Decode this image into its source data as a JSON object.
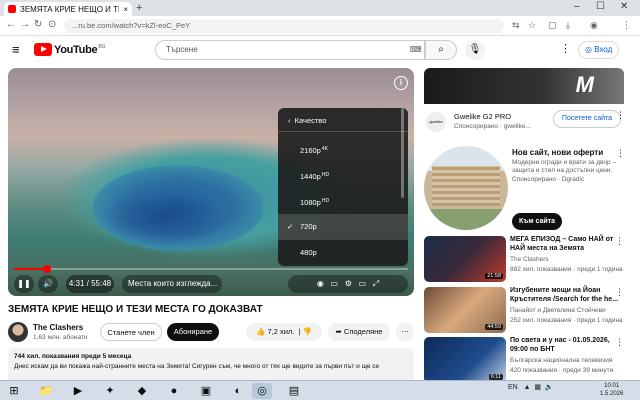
{
  "browser": {
    "tab_title": "ЗЕМЯТА КРИЕ НЕЩО И ТЕЗИ",
    "tab_close": "×",
    "new_tab": "+",
    "url": "...ru.be.com/watch?v=kZl-eoC_PeY",
    "window": {
      "minimize": "–",
      "maximize": "☐",
      "close": "✕"
    }
  },
  "youtube": {
    "logo_text": "YouTube",
    "country_code": "BG",
    "search_placeholder": "Търсене",
    "signin_label": "Вход"
  },
  "player": {
    "settings_header": "Качество",
    "quality_options": [
      {
        "label": "2160p",
        "badge": "4K"
      },
      {
        "label": "1440p",
        "badge": "HD"
      },
      {
        "label": "1080p",
        "badge": "HD"
      },
      {
        "label": "720p",
        "badge": ""
      },
      {
        "label": "480p",
        "badge": ""
      }
    ],
    "selected_quality": "720p",
    "time": "4:31 / 55:48",
    "chapter_pill": "Места които изглежда...",
    "progress_fraction": 0.083
  },
  "video": {
    "title": "ЗЕМЯТА КРИЕ НЕЩО И ТЕЗИ МЕСТА ГО ДОКАЗВАТ",
    "channel_name": "The Clashers",
    "subscribers": "1,63 млн. абонати",
    "join_label": "Станете член",
    "subscribe_label": "Абониране",
    "likes": "7,2 хил.",
    "share_label": "Споделяне",
    "description_stats": "744 хил. показвания  преди 5 месеца",
    "description_text": "Днес искам да ви покажа най-странните места на Земята! Сигурен съм, че много от тях ще видите за първи път и ще се"
  },
  "sidebar": {
    "ad1": {
      "title": "Gwelike G2 PRO",
      "sponsored": "Спонсорирано · gwelike...",
      "button": "Посетете сайта",
      "logo": "gwelike"
    },
    "ad2": {
      "title": "Нов сайт, нови оферти",
      "description": "Модерни огради и врати за двор – защита и стил на достъпни цени.",
      "sponsored": "Спонсорирано · Dgradic",
      "button": "Към сайта"
    },
    "videos": [
      {
        "title": "МЕГА ЕПИЗОД – Само НАЙ от НАЙ места на Земята",
        "channel": "The Clashers",
        "meta": "882 хил. показвания · преди 1 година",
        "duration": "21:58"
      },
      {
        "title": "Изгубените мощи на Йоан Кръстителя /Search for the he...",
        "channel": "Панайот и Дветелина Стойчеви",
        "meta": "252 хил. показвания · преди 1 година",
        "duration": "44:59"
      },
      {
        "title": "По света и у нас - 01.05.2026, 09:00 по БНТ",
        "channel": "Българска национална телевизия",
        "meta": "420 показвания · преди 39 минути",
        "duration": "6:11"
      }
    ]
  },
  "taskbar": {
    "lang": "EN",
    "time": "10:01",
    "date": "1.5.2026"
  }
}
